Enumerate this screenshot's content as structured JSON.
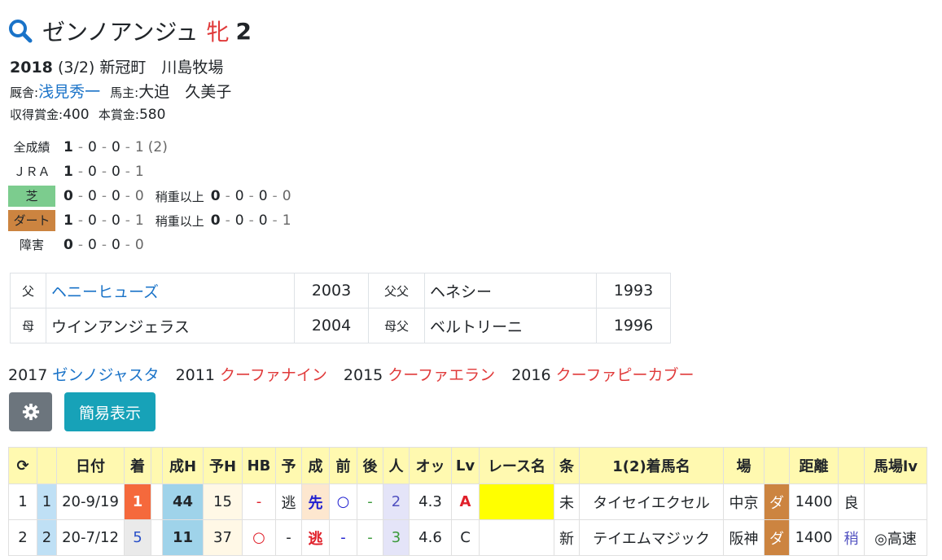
{
  "horse": {
    "name": "ゼンノアンジュ",
    "sex": "牝",
    "age": "2"
  },
  "birth": {
    "year": "2018",
    "date": "(3/2)",
    "place": "新冠町　川島牧場"
  },
  "trainer": {
    "label": "厩舎:",
    "name": "浅見秀一"
  },
  "owner": {
    "label": "馬主:",
    "name": "大迫　久美子"
  },
  "prize": {
    "earned_label": "収得賞金:",
    "earned": "400",
    "main_label": "本賞金:",
    "main": "580"
  },
  "records": {
    "all": {
      "label": "全成績",
      "w": "1",
      "s": "0",
      "t": "0",
      "o": "1",
      "extra": "(2)"
    },
    "jra": {
      "label": "ＪＲＡ",
      "w": "1",
      "s": "0",
      "t": "0",
      "o": "1"
    },
    "turf": {
      "label": "芝",
      "w": "0",
      "s": "0",
      "t": "0",
      "o": "0",
      "heavy_label": "稍重以上",
      "hw": "0",
      "hs": "0",
      "ht": "0",
      "ho": "0"
    },
    "dirt": {
      "label": "ダート",
      "w": "1",
      "s": "0",
      "t": "0",
      "o": "1",
      "heavy_label": "稍重以上",
      "hw": "0",
      "hs": "0",
      "ht": "0",
      "ho": "1"
    },
    "jump": {
      "label": "障害",
      "w": "0",
      "s": "0",
      "t": "0",
      "o": "0"
    }
  },
  "pedigree": {
    "sire_label": "父",
    "sire": "ヘニーヒューズ",
    "sire_year": "2003",
    "sire_sire_label": "父父",
    "sire_sire": "ヘネシー",
    "sire_sire_year": "1993",
    "dam_label": "母",
    "dam": "ウインアンジェラス",
    "dam_year": "2004",
    "dam_sire_label": "母父",
    "dam_sire": "ベルトリーニ",
    "dam_sire_year": "1996"
  },
  "siblings": [
    {
      "year": "2017",
      "name": "ゼンノジャスタ",
      "color": "#1a73c8"
    },
    {
      "year": "2011",
      "name": "クーファナイン",
      "color": "#e03a3a"
    },
    {
      "year": "2015",
      "name": "クーファエラン",
      "color": "#e03a3a"
    },
    {
      "year": "2016",
      "name": "クーファピーカブー",
      "color": "#e03a3a"
    }
  ],
  "buttons": {
    "settings_icon": "gear-icon",
    "simple_view": "簡易表示"
  },
  "table": {
    "headers": [
      "⟳",
      "",
      "日付",
      "着",
      "",
      "成H",
      "予H",
      "HB",
      "予",
      "成",
      "前",
      "後",
      "人",
      "オッ",
      "Lv",
      "レース名",
      "条",
      "1(2)着馬名",
      "場",
      "",
      "距離",
      "",
      "馬場lv"
    ],
    "rows": [
      [
        "1",
        "1",
        "20-9/19",
        "1",
        "",
        "44",
        "15",
        "-",
        "逃",
        "先",
        "○",
        "-",
        "2",
        "4.3",
        "A",
        "",
        "未",
        "タイセイエクセル",
        "中京",
        "ダ",
        "1400",
        "良",
        ""
      ],
      [
        "2",
        "2",
        "20-7/12",
        "5",
        "",
        "11",
        "37",
        "○",
        "-",
        "逃",
        "-",
        "-",
        "3",
        "4.6",
        "C",
        "",
        "新",
        "テイエムマジック",
        "阪神",
        "ダ",
        "1400",
        "稍",
        "◎高速"
      ]
    ]
  },
  "colors": {
    "accent": "#1a73c8",
    "filly": "#e03a3a",
    "header_bg": "#fff9b0",
    "turf": "#7ccc8e",
    "dirt": "#cc8440"
  }
}
